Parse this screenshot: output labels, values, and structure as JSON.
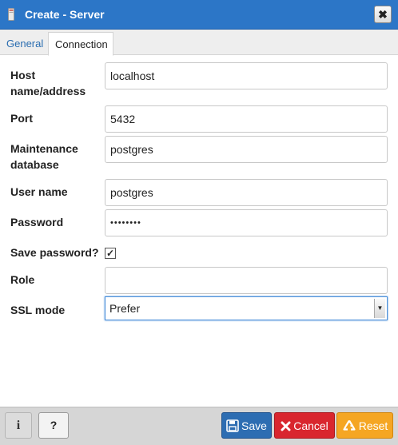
{
  "dialog": {
    "title": "Create - Server",
    "close_label": "✖"
  },
  "tabs": [
    {
      "label": "General",
      "active": false
    },
    {
      "label": "Connection",
      "active": true
    }
  ],
  "form": {
    "host_label_line1": "Host",
    "host_label_line2": "name/address",
    "host_value": "localhost",
    "port_label": "Port",
    "port_value": "5432",
    "maint_label_line1": "Maintenance",
    "maint_label_line2": "database",
    "maint_value": "postgres",
    "username_label": "User name",
    "username_value": "postgres",
    "password_label": "Password",
    "password_value": "••••••••",
    "save_password_label": "Save password?",
    "save_password_checked": "✓",
    "role_label": "Role",
    "role_value": "",
    "ssl_label": "SSL mode",
    "ssl_value": "Prefer"
  },
  "footer": {
    "info_label": "i",
    "help_label": "?",
    "save_label": "Save",
    "cancel_label": "Cancel",
    "reset_label": "Reset"
  },
  "colors": {
    "titlebar": "#2c76c7",
    "save": "#2d6db2",
    "cancel": "#d9262e",
    "reset": "#f5a623"
  }
}
